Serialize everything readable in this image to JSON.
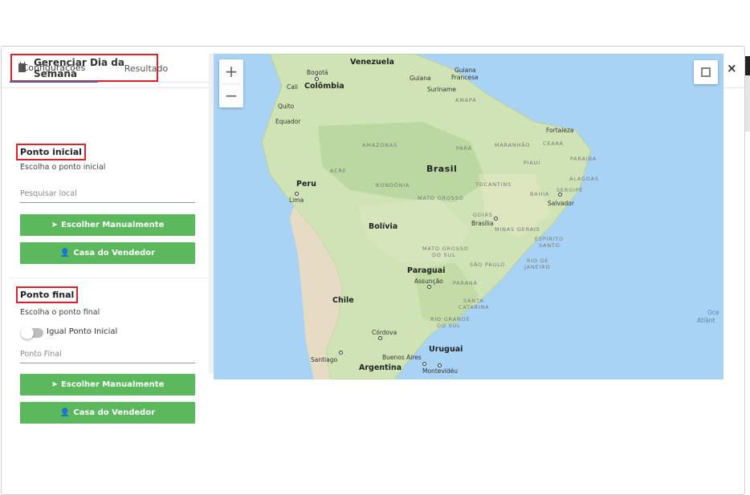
{
  "modal": {
    "title": "Gerenciar Dia da Semana",
    "close": "×",
    "icon": "calendar-icon"
  },
  "tabs": [
    {
      "label": "Configurações",
      "active": true
    },
    {
      "label": "Resultado",
      "active": false
    }
  ],
  "start": {
    "section_title": "Ponto inicial",
    "hint": "Escolha o ponto inicial",
    "search_placeholder": "Pesquisar local",
    "manual_button": "Escolher Manualmente",
    "seller_button": "Casa do Vendedor"
  },
  "end": {
    "section_title": "Ponto final",
    "hint": "Escolha o ponto final",
    "toggle_label": "Igual Ponto Inicial",
    "toggle_on": false,
    "input_placeholder": "Ponto Final",
    "manual_button": "Escolher Manualmente",
    "seller_button": "Casa do Vendedor"
  },
  "colors": {
    "accent_green": "#5cb85c",
    "highlight_red": "#d9232d",
    "tab_underline": "#3b6fb6",
    "water": "#a8d3f5",
    "land": "#cfe3b5"
  },
  "map": {
    "zoom_in": "+",
    "zoom_out": "−",
    "labels": {
      "venezuela": "Venezuela",
      "guiana": "Guiana",
      "guiana_francesa_1": "Guiana",
      "guiana_francesa_2": "Francesa",
      "suriname": "Suriname",
      "amapa": "AMAPÁ",
      "bogota": "Bogotá",
      "cali": "Cali",
      "colombia": "Colômbia",
      "quito": "Quito",
      "equador": "Equador",
      "amazonas": "AMAZONAS",
      "para": "PARÁ",
      "maranhao": "MARANHÃO",
      "ceara": "CEARÁ",
      "fortaleza": "Fortaleza",
      "piaui": "PIAUÍ",
      "paraiba": "PARAÍBA",
      "acre": "ACRE",
      "brasil": "Brasil",
      "alagoas": "ALAGOAS",
      "peru": "Peru",
      "rondonia": "RONDÔNIA",
      "tocantins": "TOCANTINS",
      "bahia": "BAHIA",
      "sergipe": "SERGIPE",
      "lima": "Lima",
      "mato_grosso": "MATO GROSSO",
      "salvador": "Salvador",
      "goias": "GOIÁS",
      "brasilia": "Brasília",
      "minas_gerais": "MINAS GERAIS",
      "bolivia": "Bolívia",
      "espirito_santo_1": "ESPÍRITO",
      "espirito_santo_2": "SANTO",
      "mato_grosso_sul_1": "MATO GROSSO",
      "mato_grosso_sul_2": "DO SUL",
      "sao_paulo": "SÃO PAULO",
      "rio_de_janeiro_1": "RIO DE",
      "rio_de_janeiro_2": "JANEIRO",
      "paraguai": "Paraguai",
      "assuncao": "Assunção",
      "parana": "PARANÁ",
      "chile": "Chile",
      "santa_catarina_1": "SANTA",
      "santa_catarina_2": "CATARINA",
      "rio_grande_sul_1": "RIO GRANDE",
      "rio_grande_sul_2": "DO SUL",
      "ocean_1": "Oce",
      "ocean_2": "Atlânt",
      "cordova": "Córdova",
      "uruguai": "Uruguai",
      "buenos_aires": "Buenos Aires",
      "santiago": "Santiago",
      "argentina": "Argentina",
      "montevideu": "Montevidéu"
    }
  }
}
